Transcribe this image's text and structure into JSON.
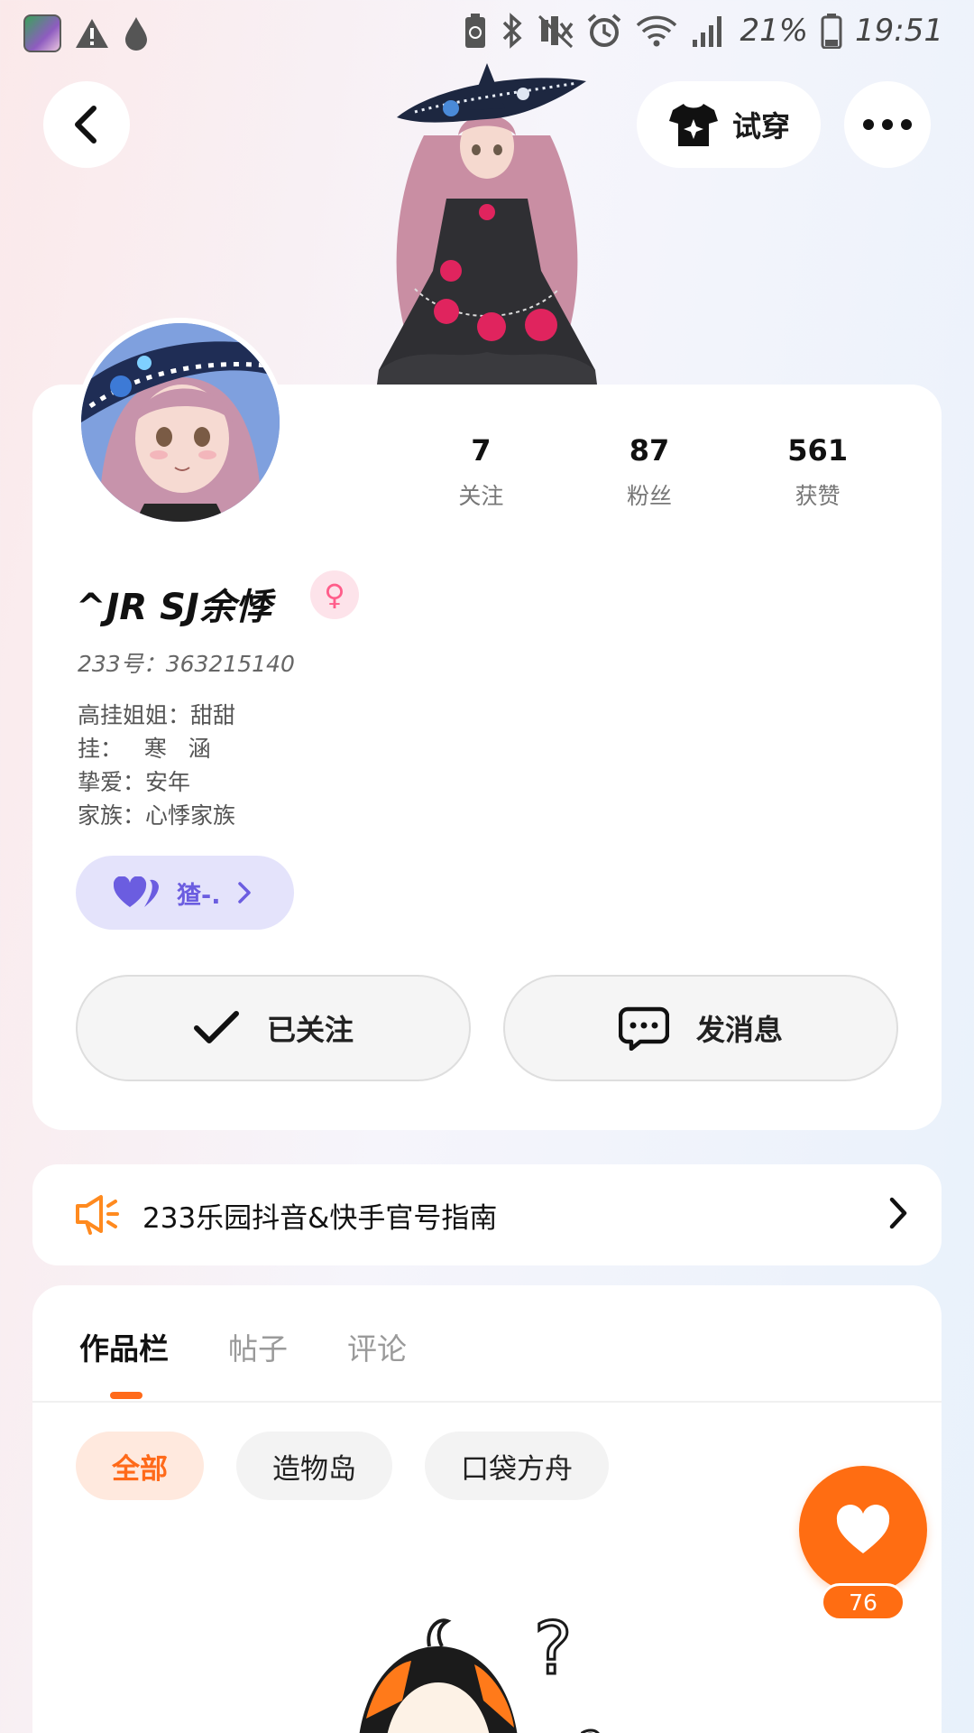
{
  "status_bar": {
    "battery_percent": "21%",
    "time": "19:51",
    "icons": [
      "app-thumbnail-icon",
      "warning-icon",
      "drop-icon",
      "battery-saver-icon",
      "bluetooth-icon",
      "mute-icon",
      "alarm-icon",
      "wifi-icon",
      "signal-icon",
      "battery-icon"
    ]
  },
  "top_bar": {
    "try_on_label": "试穿"
  },
  "profile": {
    "stats": [
      {
        "value": "7",
        "label": "关注"
      },
      {
        "value": "87",
        "label": "粉丝"
      },
      {
        "value": "561",
        "label": "获赞"
      }
    ],
    "username": "^JR  SJ余悸",
    "gender": "female",
    "uid": "233号：363215140",
    "bio_lines": [
      "高挂姐姐：甜甜",
      "挂：   寒   涵",
      "挚爱：安年",
      "家族：心悸家族"
    ],
    "tag_chip_label": "猹-.",
    "follow_button_label": "已关注",
    "message_button_label": "发消息"
  },
  "notice": {
    "text": "233乐园抖音&快手官号指南"
  },
  "works": {
    "tabs": [
      "作品栏",
      "帖子",
      "评论"
    ],
    "active_tab": "作品栏",
    "filter_chips": [
      "全部",
      "造物岛",
      "口袋方舟"
    ],
    "active_chip": "全部"
  },
  "like_fab": {
    "count": "76"
  },
  "colors": {
    "accent": "#ff6a1a",
    "tag_purple": "#6b5de0",
    "gender_pink": "#ff5d8a"
  }
}
